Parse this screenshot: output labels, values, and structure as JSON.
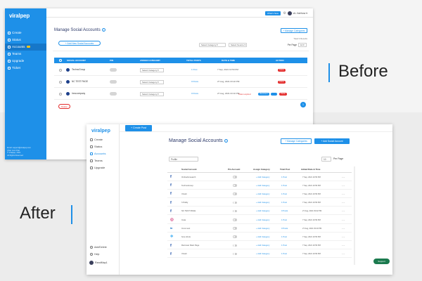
{
  "labels": {
    "before": "Before",
    "after": "After"
  },
  "colors": {
    "accent": "#1e90e8",
    "danger": "#e32b2b",
    "title": "#2d3a6a"
  },
  "before": {
    "logo": "viralpep",
    "nav": [
      {
        "label": "Create",
        "icon": "create-icon"
      },
      {
        "label": "Status",
        "icon": "status-icon"
      },
      {
        "label": "Accounts",
        "icon": "accounts-icon",
        "active": true
      },
      {
        "label": "Teams",
        "icon": "teams-icon"
      },
      {
        "label": "Upgrade",
        "icon": "upgrade-icon"
      },
      {
        "label": "Ticket",
        "icon": "ticket-icon"
      }
    ],
    "sidebar_footer": "Email: support@viralpep.com\nChat: Live Chat\n© Viralpep, 2021\nAll Rights Reserved",
    "topbar": {
      "whats_new": "What's New",
      "username": "viL.Vairhow ▾"
    },
    "page_title": "Manage Social Accounts",
    "manage_categories": "+ Manage Categories",
    "add_new": "+ Add New Social Accounts",
    "total_results": "Total 3 Results",
    "select_category": "Select Category ▾",
    "select_source": "Select Source ▾",
    "per_page_label": "Per Page",
    "per_page_value": "10 ▾",
    "columns": [
      "SOCIAL ACCOUNT",
      "PIN",
      "ASSIGN CATEGORY",
      "TOTAL POSTS",
      "DATE & TIME",
      "ACTION"
    ],
    "rows": [
      {
        "account": "TechnoGroup",
        "category": "Select Category ▾",
        "posts": "1 Post",
        "date": "7 Sep, 2021 10:50 PM",
        "action": "Delete"
      },
      {
        "account": "NC TEST PAGE",
        "category": "Select Category ▾",
        "posts": "0 Posts",
        "date": "27 Aug, 2021 03:22 PM",
        "action": "Delete"
      },
      {
        "account": "Innocompany",
        "category": "Select Category ▾",
        "posts": "0 Posts",
        "date": "27 Aug, 2021 03:10 PM",
        "token": "Token expired",
        "reconnect": "Reconnect",
        "action": "Delete"
      }
    ],
    "delete_button": "Delete",
    "page_number": "1"
  },
  "after": {
    "logo": "viralpep",
    "create_post": "+ Create Post",
    "nav": [
      {
        "label": "Create",
        "icon": "create-icon"
      },
      {
        "label": "Status",
        "icon": "status-icon"
      },
      {
        "label": "Accounts",
        "icon": "accounts-icon",
        "active": true
      },
      {
        "label": "Teams",
        "icon": "teams-icon"
      },
      {
        "label": "Upgrade",
        "icon": "upgrade-icon"
      }
    ],
    "bottom_nav": [
      {
        "label": "Add/Delete",
        "icon": "add-delete-icon"
      },
      {
        "label": "Help",
        "icon": "help-icon"
      }
    ],
    "user": "RandMap1",
    "page_title": "Manage Social Accounts",
    "manage_categories": "+ Manage Categories",
    "add_account": "+ Add Social Account",
    "filter_placeholder": "Profile",
    "per_page_value": "10",
    "per_page_label": "Per Page",
    "columns": [
      "Social Account",
      "Pin Account",
      "Assign Category",
      "Total Post",
      "Added Date & Time"
    ],
    "rows": [
      {
        "network": "facebook",
        "account": "Onlinebmsearch",
        "category": "+ Add Category",
        "posts": "1 Post",
        "date": "7 Sep, 2021 10:50 PM"
      },
      {
        "network": "facebook",
        "account": "TechnoGroup",
        "category": "+ Add Category",
        "posts": "1 Post",
        "date": "7 Sep, 2021 10:50 PM"
      },
      {
        "network": "facebook",
        "account": "Vriusli",
        "category": "+ Add Category",
        "posts": "1 Post",
        "date": "7 Sep, 2021 10:50 PM"
      },
      {
        "network": "facebook",
        "account": "h Pably",
        "category": "+ Add Category",
        "posts": "1 Post",
        "date": "7 Sep, 2021 10:50 PM"
      },
      {
        "network": "facebook",
        "account": "NC TEST PAGE",
        "category": "+ Add Category",
        "posts": "0 Posts",
        "date": "27 Aug, 2021 03:22 PM"
      },
      {
        "network": "instagram",
        "account": "Insta",
        "category": "+ Add Category",
        "posts": "1 Post",
        "date": "7 Sep, 2021 10:50 PM"
      },
      {
        "network": "linkedin",
        "account": "Innov test",
        "category": "+ Add Category",
        "posts": "0 Posts",
        "date": "27 Aug, 2021 03:10 PM"
      },
      {
        "network": "twitter",
        "account": "fune shots",
        "category": "+ Add Category",
        "posts": "1 Post",
        "date": "7 Sep, 2021 10:50 PM"
      },
      {
        "network": "facebook",
        "account": "Reiruvan Main Page",
        "category": "+ Add Category",
        "posts": "1 Post",
        "date": "7 Sep, 2021 10:50 PM"
      },
      {
        "network": "facebook",
        "account": "Vriusli",
        "category": "+ Add Category",
        "posts": "1 Post",
        "date": "7 Sep, 2021 10:50 PM"
      }
    ],
    "more": "···",
    "support": "Support"
  }
}
